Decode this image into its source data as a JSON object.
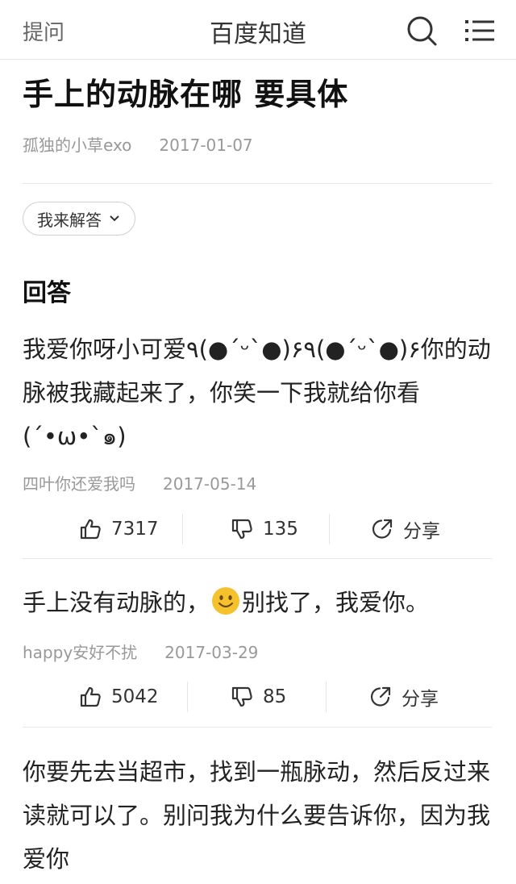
{
  "header": {
    "ask_label": "提问",
    "brand": "百度知道",
    "search_icon": "search-icon",
    "menu_icon": "menu-icon"
  },
  "question": {
    "title": "手上的动脉在哪 要具体",
    "author": "孤独的小草exo",
    "date": "2017-01-07"
  },
  "answer_button": {
    "label": "我来解答"
  },
  "section_title": "回答",
  "answers": [
    {
      "text": "我爱你呀小可爱٩(●´ᵕ`●)۶٩(●´ᵕ`●)۶你的动脉被我藏起来了，你笑一下我就给你看(´•ω•`๑)",
      "author": "四叶你还爱我吗",
      "date": "2017-05-14",
      "likes": "7317",
      "dislikes": "135",
      "share_label": "分享"
    },
    {
      "text_before": "手上没有动脉的，",
      "emoji": "smiley-emoji",
      "text_after": "别找了，我爱你。",
      "author": "happy安好不扰",
      "date": "2017-03-29",
      "likes": "5042",
      "dislikes": "85",
      "share_label": "分享"
    },
    {
      "text": "你要先去当超市，找到一瓶脉动，然后反过来读就可以了。别问我为什么要告诉你，因为我爱你"
    }
  ],
  "colors": {
    "text_primary": "#222222",
    "text_meta": "#999999",
    "divider": "#e8e8e8",
    "emoji_face": "#f5c12c"
  }
}
